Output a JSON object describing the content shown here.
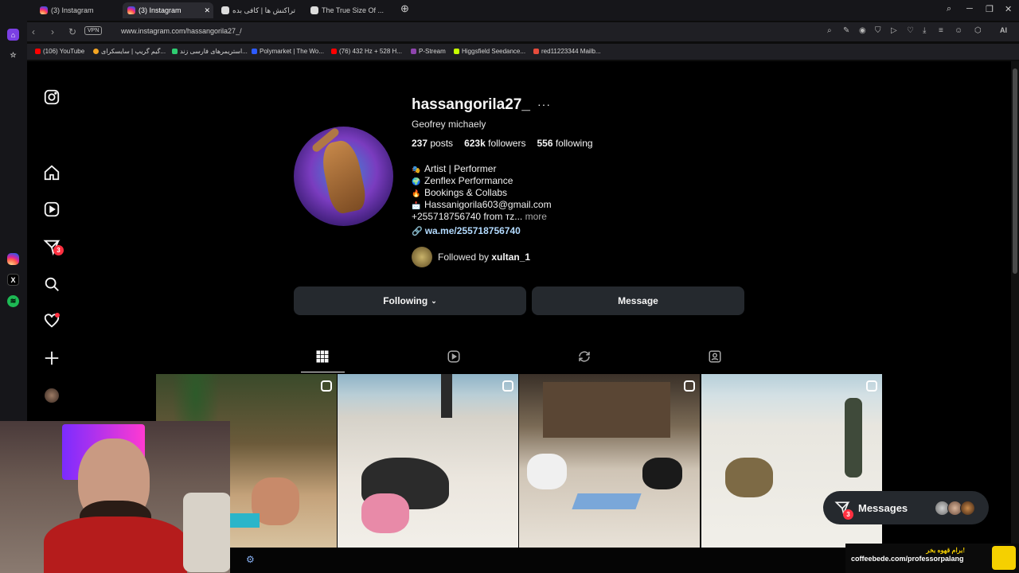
{
  "browser": {
    "tabs": [
      {
        "label": "(3) Instagram",
        "active": false
      },
      {
        "label": "(3) Instagram",
        "active": true
      },
      {
        "label": "تراکنش ها | کافی بده",
        "active": false
      },
      {
        "label": "The True Size Of ...",
        "active": false
      }
    ],
    "url": "www.instagram.com/hassangorila27_/",
    "vpn_label": "VPN",
    "ai_label": "AI",
    "bookmarks": [
      {
        "label": "(106) YouTube",
        "color": "#ff0000"
      },
      {
        "label": "گیم گریپ | سایسکرای...",
        "color": "#f5a623"
      },
      {
        "label": "استریمرهای فارسی زند...",
        "color": "#2ecc71"
      },
      {
        "label": "Polymarket | The Wo...",
        "color": "#2d5bff"
      },
      {
        "label": "(76) 432 Hz + 528 H...",
        "color": "#ff0000"
      },
      {
        "label": "P-Stream",
        "color": "#8e44ad"
      },
      {
        "label": "Higgsfield Seedance...",
        "color": "#c6ff00"
      },
      {
        "label": "red11223344 Mailb...",
        "color": "#e74c3c"
      }
    ]
  },
  "sidebar": {
    "badge_count": "3"
  },
  "profile": {
    "username": "hassangorila27_",
    "full_name": "Geofrey michaely",
    "posts_count": "237",
    "posts_label": "posts",
    "followers_count": "623k",
    "followers_label": "followers",
    "following_count": "556",
    "following_label": "following",
    "bio": [
      {
        "icon": "🎭",
        "text": "Artist | Performer"
      },
      {
        "icon": "🌍",
        "text": "Zenflex Performance"
      },
      {
        "icon": "🔥",
        "text": "Bookings & Collabs"
      },
      {
        "icon": "📩",
        "text": "Hassanigorila603@gmail.com"
      }
    ],
    "bio_last": "+255718756740 from ᴛᴢ...",
    "bio_more": "more",
    "link": "wa.me/255718756740",
    "followed_by_prefix": "Followed by",
    "followed_by_user": "xultan_1",
    "following_button": "Following",
    "message_button": "Message"
  },
  "messages": {
    "label": "Messages",
    "badge": "3"
  },
  "overlay": {
    "coffee_title": "برام قهوه بخر!",
    "coffee_url": "coffeebede.com/professorpalang"
  },
  "colors": {
    "accent_link": "#b3dbff",
    "badge": "#ff3040",
    "button_bg": "#25292e"
  }
}
